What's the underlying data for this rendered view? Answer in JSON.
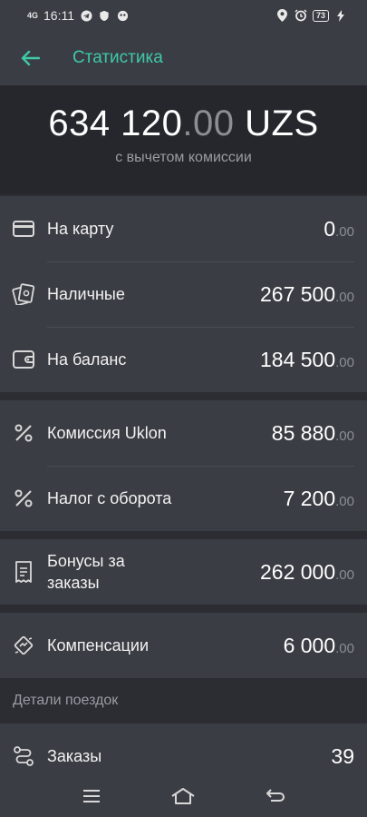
{
  "status_bar": {
    "time": "16:11",
    "network": "4G",
    "battery": "73"
  },
  "header": {
    "title": "Статистика"
  },
  "summary": {
    "amount_main": "634 120",
    "amount_cents": ".00",
    "currency": " UZS",
    "subtitle": "с вычетом комиссии"
  },
  "groups": [
    {
      "rows": [
        {
          "label": "На карту",
          "amount": "0",
          "cents": ".00",
          "icon": "credit-card-icon"
        },
        {
          "label": "Наличные",
          "amount": "267 500",
          "cents": ".00",
          "icon": "cash-icon"
        },
        {
          "label": "На баланс",
          "amount": "184 500",
          "cents": ".00",
          "icon": "wallet-icon"
        }
      ]
    },
    {
      "rows": [
        {
          "label": "Комиссия Uklon",
          "amount": "85 880",
          "cents": ".00",
          "icon": "percent-icon"
        },
        {
          "label": "Налог с оборота",
          "amount": "7 200",
          "cents": ".00",
          "icon": "percent-icon"
        }
      ]
    },
    {
      "rows": [
        {
          "label_line1": "Бонусы за",
          "label_line2": "заказы",
          "amount": "262 000",
          "cents": ".00",
          "icon": "receipt-icon"
        }
      ]
    },
    {
      "rows": [
        {
          "label": "Компенсации",
          "amount": "6 000",
          "cents": ".00",
          "icon": "compensation-icon"
        }
      ]
    }
  ],
  "trip_details": {
    "header": "Детали поездок",
    "rows": [
      {
        "label": "Заказы",
        "value": "39",
        "icon": "route-icon"
      }
    ]
  },
  "colors": {
    "accent": "#3ec9a7",
    "background": "#2b2d33",
    "card": "#3b3d44",
    "hero": "#25272c",
    "muted": "#8c8e95"
  }
}
